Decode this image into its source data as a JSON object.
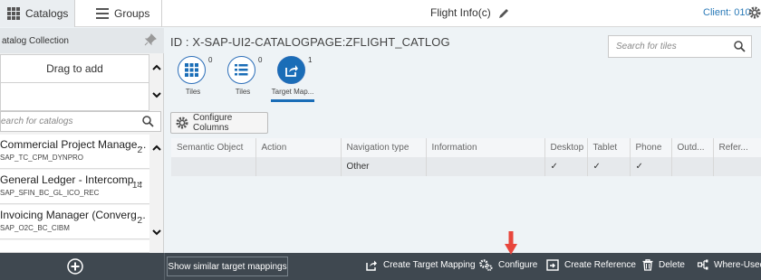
{
  "header": {
    "tabs": [
      {
        "label": "Catalogs",
        "icon": "grid-icon"
      },
      {
        "label": "Groups",
        "icon": "list-icon"
      }
    ],
    "title": "Flight Info(c)",
    "client": "Client: 010"
  },
  "left_panel": {
    "title": "atalog Collection",
    "drag_label": "Drag to add",
    "search_placeholder": "earch for catalogs",
    "catalogs": [
      {
        "name": "Commercial Project Manage...",
        "code": "SAP_TC_CPM_DYNPRO",
        "count": "2"
      },
      {
        "name": "General Ledger - Intercomp...",
        "code": "SAP_SFIN_BC_GL_ICO_REC",
        "count": "14"
      },
      {
        "name": "Invoicing Manager (Converg...",
        "code": "SAP_O2C_BC_CIBM",
        "count": "2"
      }
    ]
  },
  "main": {
    "catalog_id": "ID : X-SAP-UI2-CATALOGPAGE:ZFLIGHT_CATLOG",
    "tile_search_placeholder": "Search for tiles",
    "icon_tabs": [
      {
        "label": "Tiles",
        "count": "0",
        "icon": "tiles-grid-icon"
      },
      {
        "label": "Tiles",
        "count": "0",
        "icon": "tiles-list-icon"
      },
      {
        "label": "Target Map...",
        "count": "1",
        "icon": "target-mapping-icon",
        "selected": true
      }
    ],
    "configure_columns_label": "Configure Columns",
    "table": {
      "columns": [
        "Semantic Object",
        "Action",
        "Navigation type",
        "Information",
        "Desktop",
        "Tablet",
        "Phone",
        "Outd...",
        "Refer..."
      ],
      "rows": [
        [
          "",
          "",
          "Other",
          "",
          "✓",
          "✓",
          "✓",
          "",
          ""
        ]
      ]
    }
  },
  "footer": {
    "similar_label": "Show similar target mappings",
    "actions": [
      {
        "label": "Create Target Mapping",
        "icon": "create-mapping-icon"
      },
      {
        "label": "Configure",
        "icon": "configure-icon"
      },
      {
        "label": "Create Reference",
        "icon": "create-reference-icon"
      },
      {
        "label": "Delete",
        "icon": "trash-icon"
      },
      {
        "label": "Where-Used",
        "icon": "where-used-icon"
      }
    ]
  },
  "colors": {
    "accent": "#1a6db7",
    "footer_bg": "#3f4850",
    "arrow": "#e8463c"
  }
}
